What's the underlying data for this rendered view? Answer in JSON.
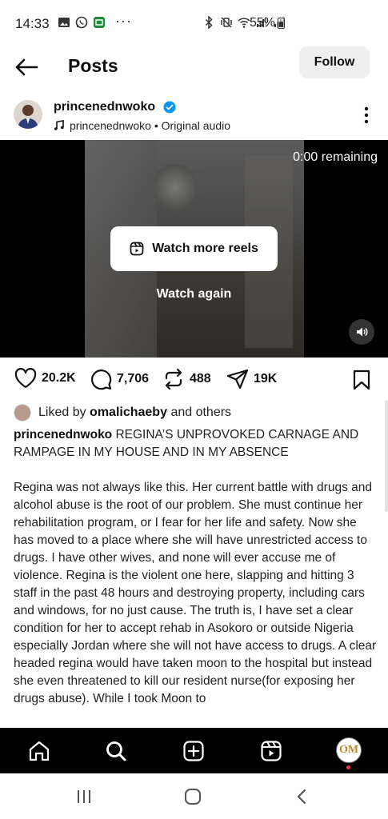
{
  "status_bar": {
    "time": "14:33",
    "left_icons": [
      "gallery-icon",
      "whatsapp-icon",
      "app-icon"
    ],
    "overflow": "···",
    "battery": "55%"
  },
  "header": {
    "title": "Posts",
    "follow_label": "Follow"
  },
  "author": {
    "username": "princenednwoko",
    "audio_text": "princenednwoko • Original audio"
  },
  "video": {
    "remaining": "0:00 remaining",
    "watch_more_label": "Watch more reels",
    "watch_again_label": "Watch again"
  },
  "actions": {
    "likes": "20.2K",
    "comments": "7,706",
    "reposts": "488",
    "shares": "19K"
  },
  "liked_by": {
    "prefix": "Liked by",
    "user": "omalichaeby",
    "suffix": "and others"
  },
  "caption": {
    "user": "princenednwoko",
    "headline": "REGINA’S UNPROVOKED CARNAGE AND RAMPAGE IN MY HOUSE AND IN MY ABSENCE",
    "body": "Regina was not always like this. Her current battle with drugs and alcohol abuse is the root of our problem. She must continue her rehabilitation program, or I fear for her life and safety. Now she has moved to a place where she will have unrestricted access to drugs. I have other wives, and none will ever accuse me of violence. Regina is the violent one here, slapping and hitting 3 staff in the past 48 hours and destroying property, including cars and windows, for no just cause. The truth is, I have set a clear condition for her to accept rehab in Asokoro or outside Nigeria especially Jordan where she will not have access to drugs. A clear headed regina would have taken moon to the hospital but instead she even threatened to kill our resident nurse(for exposing her drugs abuse). While I took Moon to"
  },
  "bottom_nav": {
    "items": [
      "home-icon",
      "search-icon",
      "create-icon",
      "reels-icon",
      "profile-avatar"
    ],
    "profile_initials": "OM"
  },
  "colors": {
    "verified": "#0095f6",
    "follow_bg": "#efefef",
    "notification_dot": "#ff3040"
  }
}
